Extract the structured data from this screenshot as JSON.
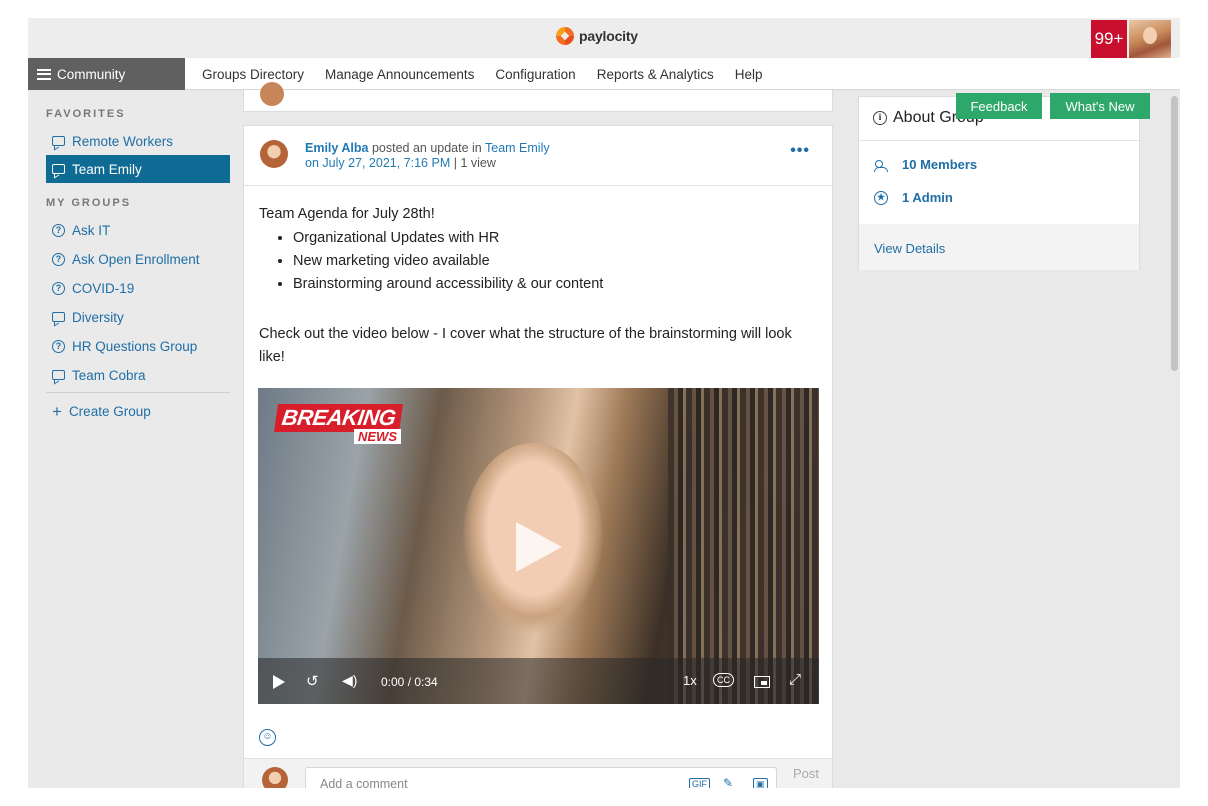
{
  "header": {
    "brand": "paylocity",
    "notification_count": "99+"
  },
  "nav": {
    "menu_label": "Community",
    "links": [
      "Groups Directory",
      "Manage Announcements",
      "Configuration",
      "Reports & Analytics",
      "Help"
    ]
  },
  "sidebar": {
    "favorites_heading": "FAVORITES",
    "favorites": [
      {
        "label": "Remote Workers",
        "icon": "chat-icon"
      },
      {
        "label": "Team Emily",
        "icon": "chat-icon",
        "active": true
      }
    ],
    "groups_heading": "MY GROUPS",
    "groups": [
      {
        "label": "Ask IT",
        "icon": "question-icon"
      },
      {
        "label": "Ask Open Enrollment",
        "icon": "question-icon"
      },
      {
        "label": "COVID-19",
        "icon": "question-icon"
      },
      {
        "label": "Diversity",
        "icon": "chat-icon"
      },
      {
        "label": "HR Questions Group",
        "icon": "question-icon"
      },
      {
        "label": "Team Cobra",
        "icon": "chat-icon"
      }
    ],
    "create_group": "Create Group"
  },
  "post": {
    "author": "Emily Alba",
    "action_text": "posted an update in",
    "group": "Team Emily",
    "timestamp": "on July 27, 2021, 7:16 PM",
    "views": "| 1 view",
    "more": "•••",
    "intro": "Team Agenda for July 28th!",
    "bullets": [
      "Organizational Updates with HR",
      "New marketing video available",
      "Brainstorming around accessibility & our content"
    ],
    "body2": "Check out the video below - I cover what the structure of the brainstorming will look like!",
    "video": {
      "overlay_title": "BREAKING",
      "overlay_sub": "NEWS",
      "time": "0:00 / 0:34",
      "speed": "1x",
      "cc": "CC",
      "progress": 0
    },
    "comment_placeholder": "Add a comment",
    "comment_gif": "GIF",
    "post_label": "Post"
  },
  "about": {
    "title": "About Group",
    "members": "10 Members",
    "admins": "1 Admin",
    "details_link": "View Details"
  },
  "buttons": {
    "feedback": "Feedback",
    "whats_new": "What's New"
  },
  "colors": {
    "link_blue": "#1f6ea6",
    "active_blue": "#0f6b93",
    "green": "#2ea86a",
    "notif_red": "#c8102e",
    "nav_gray": "#606060"
  }
}
